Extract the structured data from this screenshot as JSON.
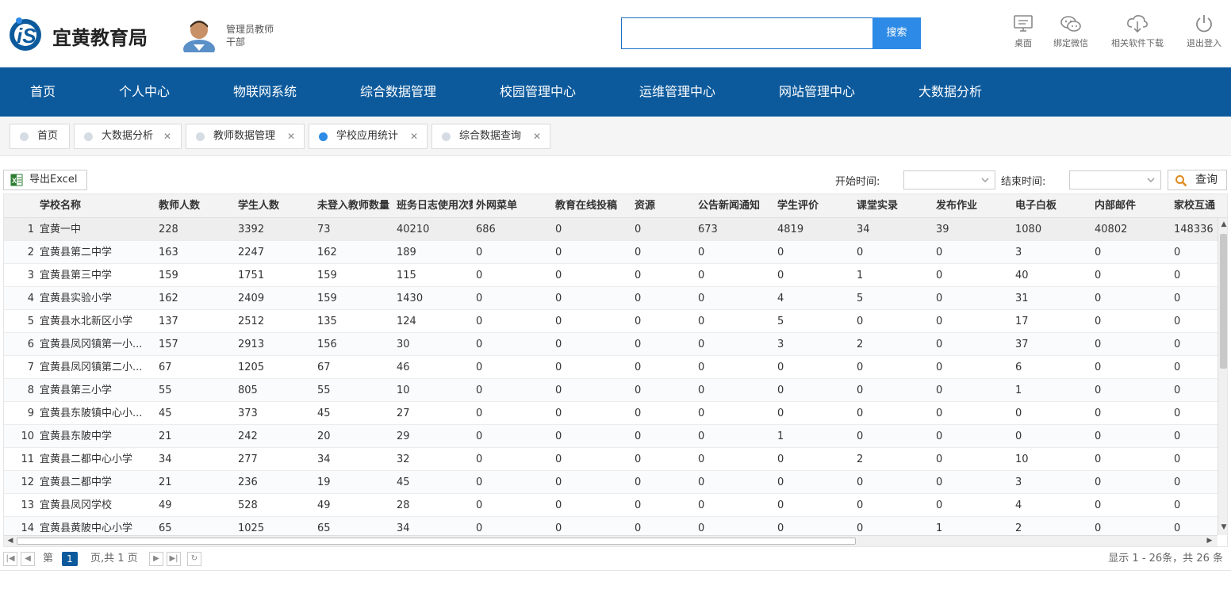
{
  "header": {
    "logo_text": "宜黄教育局",
    "user_name": "管理员教师",
    "user_role": "干部",
    "search_placeholder": "",
    "search_button": "搜索",
    "icons": [
      {
        "name": "desktop-icon",
        "label": "桌面"
      },
      {
        "name": "wechat-icon",
        "label": "绑定微信"
      },
      {
        "name": "download-icon",
        "label": "相关软件下载"
      },
      {
        "name": "power-icon",
        "label": "退出登入"
      }
    ]
  },
  "nav": {
    "items": [
      "首页",
      "个人中心",
      "物联网系统",
      "综合数据管理",
      "校园管理中心",
      "运维管理中心",
      "网站管理中心",
      "大数据分析"
    ]
  },
  "tabs": [
    {
      "label": "首页",
      "closable": false,
      "active": false
    },
    {
      "label": "大数据分析",
      "closable": true,
      "active": false
    },
    {
      "label": "教师数据管理",
      "closable": true,
      "active": false
    },
    {
      "label": "学校应用统计",
      "closable": true,
      "active": true
    },
    {
      "label": "综合数据查询",
      "closable": true,
      "active": false
    }
  ],
  "toolbar": {
    "export_label": "导出Excel",
    "start_label": "开始时间:",
    "end_label": "结束时间:",
    "start_value": "",
    "end_value": "",
    "query_label": "查询"
  },
  "table": {
    "columns": [
      "学校名称",
      "教师人数",
      "学生人数",
      "未登入教师数量",
      "班务日志使用次数",
      "外网菜单",
      "教育在线投稿",
      "资源",
      "公告新闻通知",
      "学生评价",
      "课堂实录",
      "发布作业",
      "电子白板",
      "内部邮件",
      "家校互通"
    ],
    "rows": [
      [
        "1",
        "宜黄一中",
        "228",
        "3392",
        "73",
        "40210",
        "686",
        "0",
        "0",
        "673",
        "4819",
        "34",
        "39",
        "1080",
        "40802",
        "148336"
      ],
      [
        "2",
        "宜黄县第二中学",
        "163",
        "2247",
        "162",
        "189",
        "0",
        "0",
        "0",
        "0",
        "0",
        "0",
        "0",
        "3",
        "0",
        "0"
      ],
      [
        "3",
        "宜黄县第三中学",
        "159",
        "1751",
        "159",
        "115",
        "0",
        "0",
        "0",
        "0",
        "0",
        "1",
        "0",
        "40",
        "0",
        "0"
      ],
      [
        "4",
        "宜黄县实验小学",
        "162",
        "2409",
        "159",
        "1430",
        "0",
        "0",
        "0",
        "0",
        "4",
        "5",
        "0",
        "31",
        "0",
        "0"
      ],
      [
        "5",
        "宜黄县水北新区小学",
        "137",
        "2512",
        "135",
        "124",
        "0",
        "0",
        "0",
        "0",
        "5",
        "0",
        "0",
        "17",
        "0",
        "0"
      ],
      [
        "6",
        "宜黄县凤冈镇第一小...",
        "157",
        "2913",
        "156",
        "30",
        "0",
        "0",
        "0",
        "0",
        "3",
        "2",
        "0",
        "37",
        "0",
        "0"
      ],
      [
        "7",
        "宜黄县凤冈镇第二小...",
        "67",
        "1205",
        "67",
        "46",
        "0",
        "0",
        "0",
        "0",
        "0",
        "0",
        "0",
        "6",
        "0",
        "0"
      ],
      [
        "8",
        "宜黄县第三小学",
        "55",
        "805",
        "55",
        "10",
        "0",
        "0",
        "0",
        "0",
        "0",
        "0",
        "0",
        "1",
        "0",
        "0"
      ],
      [
        "9",
        "宜黄县东陂镇中心小...",
        "45",
        "373",
        "45",
        "27",
        "0",
        "0",
        "0",
        "0",
        "0",
        "0",
        "0",
        "0",
        "0",
        "0"
      ],
      [
        "10",
        "宜黄县东陂中学",
        "21",
        "242",
        "20",
        "29",
        "0",
        "0",
        "0",
        "0",
        "1",
        "0",
        "0",
        "0",
        "0",
        "0"
      ],
      [
        "11",
        "宜黄县二都中心小学",
        "34",
        "277",
        "34",
        "32",
        "0",
        "0",
        "0",
        "0",
        "0",
        "2",
        "0",
        "10",
        "0",
        "0"
      ],
      [
        "12",
        "宜黄县二都中学",
        "21",
        "236",
        "19",
        "45",
        "0",
        "0",
        "0",
        "0",
        "0",
        "0",
        "0",
        "3",
        "0",
        "0"
      ],
      [
        "13",
        "宜黄县凤冈学校",
        "49",
        "528",
        "49",
        "28",
        "0",
        "0",
        "0",
        "0",
        "0",
        "0",
        "0",
        "4",
        "0",
        "0"
      ],
      [
        "14",
        "宜黄县黄陂中心小学",
        "65",
        "1025",
        "65",
        "34",
        "0",
        "0",
        "0",
        "0",
        "0",
        "0",
        "1",
        "2",
        "0",
        "0"
      ]
    ]
  },
  "pager": {
    "prefix": "第",
    "current": "1",
    "suffix": "页,共 1 页",
    "info": "显示 1 - 26条，共 26 条"
  }
}
